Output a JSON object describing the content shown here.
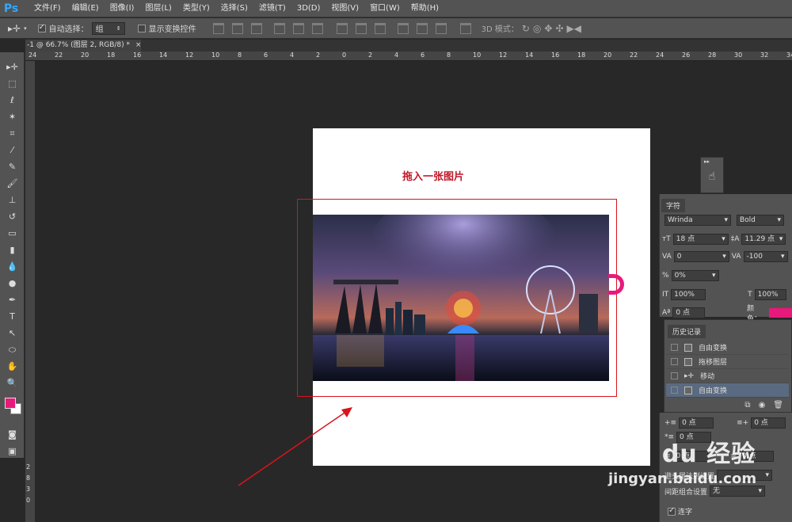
{
  "app": {
    "logo": "Ps"
  },
  "menu": [
    "文件(F)",
    "编辑(E)",
    "图像(I)",
    "图层(L)",
    "类型(Y)",
    "选择(S)",
    "滤镜(T)",
    "3D(D)",
    "视图(V)",
    "窗口(W)",
    "帮助(H)"
  ],
  "options": {
    "auto_select_label": "自动选择：",
    "auto_select_value": "组",
    "show_transform_label": "显示变换控件",
    "mode_3d_label": "3D 模式："
  },
  "document_tab": {
    "title": "-1 @ 66.7% (图层 2, RGB/8) *",
    "close": "×"
  },
  "ruler_h": [
    "24",
    "22",
    "20",
    "18",
    "16",
    "14",
    "12",
    "10",
    "8",
    "6",
    "4",
    "2",
    "0",
    "2",
    "4",
    "6",
    "8",
    "10",
    "12",
    "14",
    "16",
    "18",
    "20",
    "22",
    "24",
    "26",
    "28",
    "30",
    "32",
    "34"
  ],
  "ruler_v": [
    "2",
    "8",
    "3",
    "0"
  ],
  "canvas": {
    "instruction": "拖入一张图片"
  },
  "character_panel": {
    "tab": "字符",
    "font_family": "Wrinda",
    "font_style": "Bold",
    "size": "18 点",
    "leading": "11.29 点",
    "kerning": "0",
    "tracking": "-100",
    "scale_pct": "0%",
    "vertical_scale": "100%",
    "horizontal_scale": "100%",
    "baseline": "0 点",
    "color_label": "颜色："
  },
  "history_panel": {
    "tab": "历史记录",
    "items": [
      {
        "label": "自由变换",
        "selected": false
      },
      {
        "label": "拖移图层",
        "selected": false
      },
      {
        "label": "移动",
        "selected": false
      },
      {
        "label": "自由变换",
        "selected": true
      }
    ]
  },
  "paragraph_panel": {
    "fields": [
      "0 点",
      "0 点",
      "0 点",
      "0 点",
      "0 点"
    ],
    "row1": "避头尾法则设置",
    "row2": "间距组合设置",
    "row2_value": "无",
    "hyphenate": "连字"
  },
  "watermark": {
    "brand": "Bai du 经验",
    "url": "jingyan.baidu.com"
  },
  "colors": {
    "foreground": "#e8197a",
    "accent": "#d8141c",
    "ps_blue": "#31a8ff"
  }
}
